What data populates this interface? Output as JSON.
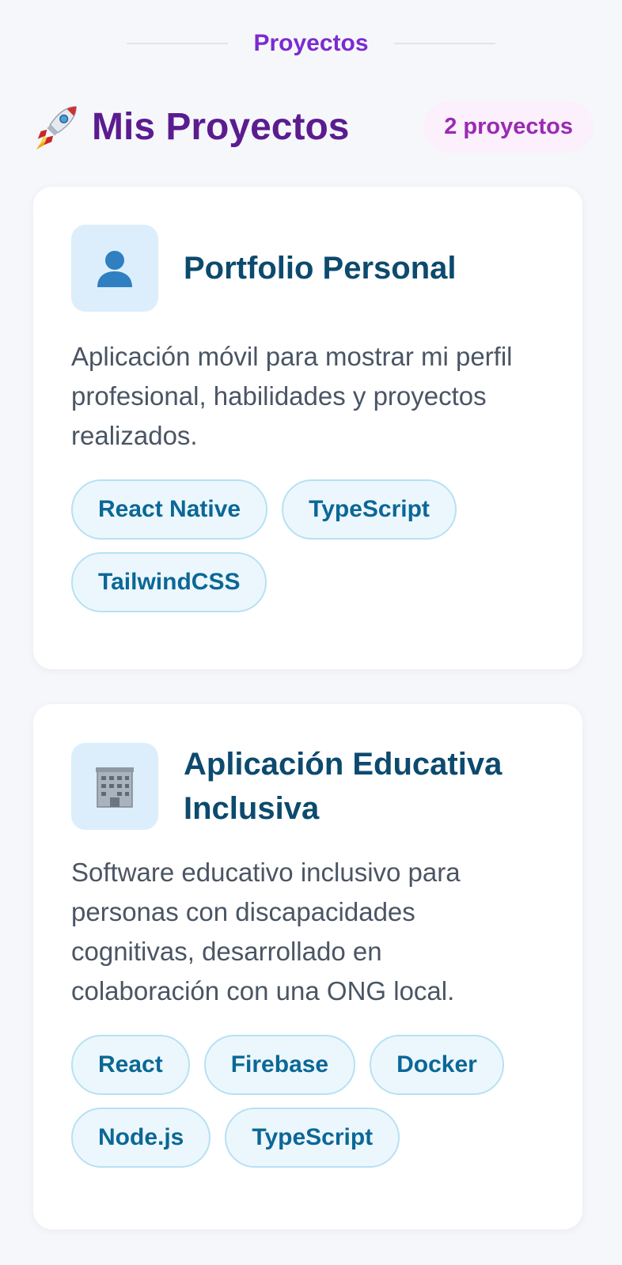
{
  "section": {
    "label": "Proyectos"
  },
  "header": {
    "title": "Mis Proyectos",
    "count": "2 proyectos",
    "icon": "rocket-icon"
  },
  "projects": [
    {
      "icon": "person-silhouette-icon",
      "title": "Portfolio Personal",
      "description": "Aplicación móvil para mostrar mi perfil profesional, habilidades y proyectos realizados.",
      "tags": [
        "React Native",
        "TypeScript",
        "TailwindCSS"
      ]
    },
    {
      "icon": "office-building-icon",
      "title": "Aplicación Educativa Inclusiva",
      "description": "Software educativo inclusivo para personas con discapacidades cognitivas, desarrollado en colaboración con una ONG local.",
      "tags": [
        "React",
        "Firebase",
        "Docker",
        "Node.js",
        "TypeScript"
      ]
    }
  ],
  "colors": {
    "background": "#f6f7fb",
    "section_label": "#7b2bd0",
    "title": "#5b1c8f",
    "badge_bg": "#fbf0fb",
    "badge_text": "#9a2ab3",
    "card_title": "#0c4a6e",
    "tag_bg": "#ecf7fd",
    "tag_border": "#b7e1f3",
    "tag_text": "#0b6796"
  }
}
